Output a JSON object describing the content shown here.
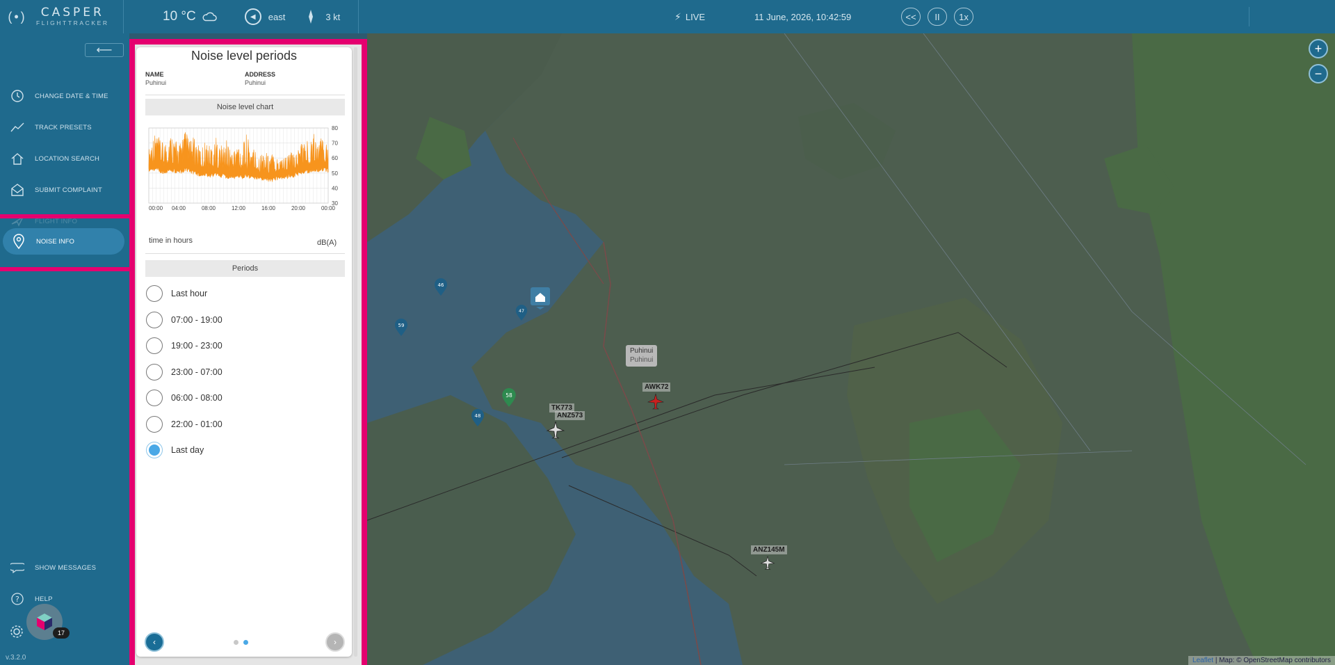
{
  "app": {
    "logo_main": "CASPER",
    "logo_sub": "FLIGHTTRACKER",
    "version": "v.3.2.0"
  },
  "topbar": {
    "temperature": "10 °C",
    "weather_icon": "cloud-icon",
    "wind_direction": "east",
    "wind_speed": "3 kt",
    "live_label": "LIVE",
    "datetime": "11 June, 2026, 10:42:59",
    "rewind_label": "<<",
    "pause_label": "II",
    "speed_label": "1x"
  },
  "sidebar": {
    "items": [
      {
        "label": "CHANGE DATE & TIME",
        "icon": "clock-icon"
      },
      {
        "label": "TRACK PRESETS",
        "icon": "trend-line-icon"
      },
      {
        "label": "LOCATION SEARCH",
        "icon": "home-icon"
      },
      {
        "label": "SUBMIT COMPLAINT",
        "icon": "envelope-icon"
      },
      {
        "label": "FLIGHT INFO",
        "icon": "plane-icon"
      },
      {
        "label": "NOISE INFO",
        "icon": "location-pin-icon"
      }
    ],
    "bottom_items": [
      {
        "label": "SHOW MESSAGES",
        "icon": "chat-bubble-icon"
      },
      {
        "label": "HELP",
        "icon": "question-icon"
      }
    ],
    "badge_count": "17"
  },
  "panel": {
    "title": "Noise level periods",
    "name_label": "NAME",
    "name_value": "Puhinui",
    "address_label": "ADDRESS",
    "address_value": "Puhinui",
    "chart_header": "Noise level chart",
    "periods_header": "Periods",
    "periods": [
      {
        "label": "Last hour",
        "selected": false
      },
      {
        "label": "07:00 - 19:00",
        "selected": false
      },
      {
        "label": "19:00 - 23:00",
        "selected": false
      },
      {
        "label": "23:00 - 07:00",
        "selected": false
      },
      {
        "label": "06:00 - 08:00",
        "selected": false
      },
      {
        "label": "22:00 - 01:00",
        "selected": false
      },
      {
        "label": "Last day",
        "selected": true
      }
    ],
    "page_count": 2,
    "active_page": 2
  },
  "chart_data": {
    "type": "area",
    "xlabel": "time in hours",
    "ylabel": "dB(A)",
    "x_ticks": [
      "00:00",
      "04:00",
      "08:00",
      "12:00",
      "16:00",
      "20:00",
      "00:00"
    ],
    "y_ticks": [
      80,
      70,
      60,
      50,
      40,
      30
    ],
    "ylim": [
      30,
      80
    ],
    "xlim_hours": [
      0,
      24
    ],
    "grid": true,
    "series": [
      {
        "color": "#f7941d",
        "x_hours": [
          0,
          0.5,
          1,
          1.5,
          2,
          2.5,
          3,
          3.5,
          4,
          4.5,
          5,
          5.5,
          6,
          6.5,
          7,
          7.5,
          8,
          8.5,
          9,
          9.5,
          10,
          10.5,
          11,
          11.5,
          12,
          12.5,
          13,
          13.5,
          14,
          14.5,
          15,
          15.5,
          16,
          16.5,
          17,
          17.5,
          18,
          18.5,
          19,
          19.5,
          20,
          20.5,
          21,
          21.5,
          22,
          22.5,
          23,
          23.5,
          24
        ],
        "peak_dba": [
          66,
          74,
          78,
          72,
          70,
          75,
          77,
          73,
          68,
          76,
          79,
          71,
          74,
          70,
          66,
          72,
          69,
          71,
          74,
          68,
          70,
          73,
          65,
          67,
          72,
          66,
          77,
          70,
          68,
          64,
          63,
          66,
          62,
          64,
          60,
          63,
          61,
          62,
          64,
          62,
          67,
          73,
          70,
          75,
          78,
          71,
          74,
          72,
          70
        ],
        "base_dba": [
          55,
          56,
          57,
          55,
          54,
          55,
          56,
          55,
          54,
          55,
          56,
          55,
          54,
          53,
          52,
          53,
          52,
          52,
          53,
          52,
          52,
          51,
          52,
          51,
          52,
          51,
          52,
          51,
          51,
          50,
          50,
          50,
          49,
          49,
          50,
          50,
          51,
          51,
          52,
          52,
          53,
          54,
          55,
          55,
          56,
          55,
          56,
          56,
          55
        ]
      }
    ]
  },
  "map": {
    "flights": [
      "AWK72",
      "ANZ573",
      "TK773",
      "ANZ145M"
    ],
    "location_tooltip": {
      "title": "Puhinui",
      "subtitle": "Puhinui"
    },
    "markers": [
      {
        "label": "46"
      },
      {
        "label": "59"
      },
      {
        "label": "47"
      },
      {
        "label": "48"
      },
      {
        "label": "58"
      }
    ],
    "zoom_in": "+",
    "zoom_out": "−",
    "attribution_leaflet": "Leaflet",
    "attribution_rest": " | Map: © OpenStreetMap contributors"
  },
  "colors": {
    "accent": "#e5006f",
    "topbar": "#1f6a8d",
    "chart_fill": "#f7941d",
    "radio_selected": "#4aa8e6"
  }
}
